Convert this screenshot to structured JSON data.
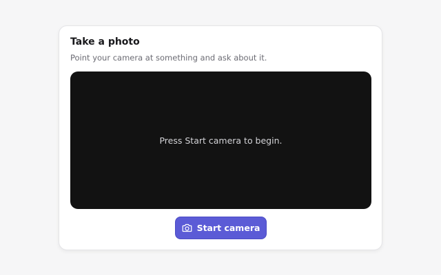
{
  "card": {
    "title": "Take a photo",
    "subtitle": "Point your camera at something and ask about it."
  },
  "viewport": {
    "message": "Press Start camera to begin."
  },
  "actions": {
    "start_label": "Start camera",
    "start_icon": "camera-icon"
  },
  "colors": {
    "accent": "#5b5bd6",
    "viewport_bg": "#121212",
    "page_bg": "#f6f6f7"
  }
}
